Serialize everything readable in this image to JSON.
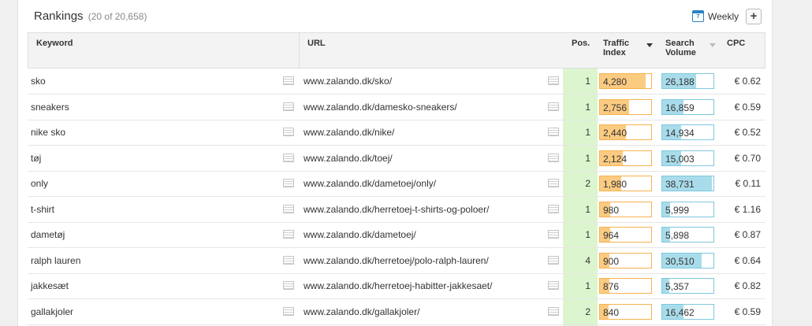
{
  "header": {
    "title": "Rankings",
    "count": "(20 of 20,658)",
    "period_label": "Weekly",
    "calendar_icon_text": "7",
    "add_label": "+"
  },
  "columns": {
    "keyword": "Keyword",
    "url": "URL",
    "pos": "Pos.",
    "traffic_line1": "Traffic",
    "traffic_line2": "Index",
    "search_line1": "Search",
    "search_line2": "Volume",
    "cpc": "CPC"
  },
  "scales": {
    "traffic_max": 4800,
    "search_max": 40000
  },
  "colors": {
    "traffic_fill": "#fbcb81",
    "traffic_border": "#f6b24f",
    "search_fill": "#a9dcea",
    "search_border": "#7ec8dd",
    "position_bg": "#dcf5cf"
  },
  "rows": [
    {
      "keyword": "sko",
      "url": "www.zalando.dk/sko/",
      "pos": "1",
      "traffic": "4,280",
      "traffic_value": 4280,
      "search": "26,188",
      "search_value": 26188,
      "cpc": "€ 0.62"
    },
    {
      "keyword": "sneakers",
      "url": "www.zalando.dk/damesko-sneakers/",
      "pos": "1",
      "traffic": "2,756",
      "traffic_value": 2756,
      "search": "16,859",
      "search_value": 16859,
      "cpc": "€ 0.59"
    },
    {
      "keyword": "nike sko",
      "url": "www.zalando.dk/nike/",
      "pos": "1",
      "traffic": "2,440",
      "traffic_value": 2440,
      "search": "14,934",
      "search_value": 14934,
      "cpc": "€ 0.52"
    },
    {
      "keyword": "tøj",
      "url": "www.zalando.dk/toej/",
      "pos": "1",
      "traffic": "2,124",
      "traffic_value": 2124,
      "search": "15,003",
      "search_value": 15003,
      "cpc": "€ 0.70"
    },
    {
      "keyword": "only",
      "url": "www.zalando.dk/dametoej/only/",
      "pos": "2",
      "traffic": "1,980",
      "traffic_value": 1980,
      "search": "38,731",
      "search_value": 38731,
      "cpc": "€ 0.11"
    },
    {
      "keyword": "t-shirt",
      "url": "www.zalando.dk/herretoej-t-shirts-og-poloer/",
      "pos": "1",
      "traffic": "980",
      "traffic_value": 980,
      "search": "5,999",
      "search_value": 5999,
      "cpc": "€ 1.16"
    },
    {
      "keyword": "dametøj",
      "url": "www.zalando.dk/dametoej/",
      "pos": "1",
      "traffic": "964",
      "traffic_value": 964,
      "search": "5,898",
      "search_value": 5898,
      "cpc": "€ 0.87"
    },
    {
      "keyword": "ralph lauren",
      "url": "www.zalando.dk/herretoej/polo-ralph-lauren/",
      "pos": "4",
      "traffic": "900",
      "traffic_value": 900,
      "search": "30,510",
      "search_value": 30510,
      "cpc": "€ 0.64"
    },
    {
      "keyword": "jakkesæt",
      "url": "www.zalando.dk/herretoej-habitter-jakkesaet/",
      "pos": "1",
      "traffic": "876",
      "traffic_value": 876,
      "search": "5,357",
      "search_value": 5357,
      "cpc": "€ 0.82"
    },
    {
      "keyword": "gallakjoler",
      "url": "www.zalando.dk/gallakjoler/",
      "pos": "2",
      "traffic": "840",
      "traffic_value": 840,
      "search": "16,462",
      "search_value": 16462,
      "cpc": "€ 0.59"
    }
  ]
}
